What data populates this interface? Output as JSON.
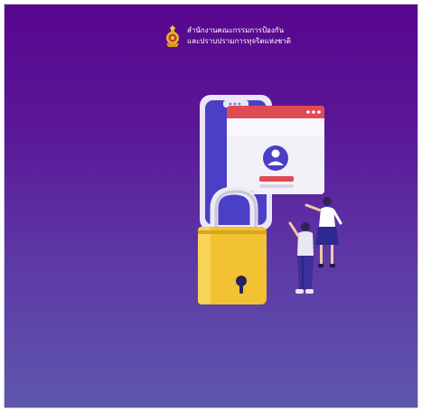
{
  "header": {
    "emblem_icon": "royal-emblem-icon",
    "org_name_line1": "สำนักงานคณะกรรมการป้องกัน",
    "org_name_line2": "และปราบปรามการทุจริตแห่งชาติ"
  },
  "illustration": {
    "phone_icon": "smartphone-icon",
    "login_window_icon": "login-window-icon",
    "user_icon": "user-avatar-icon",
    "lock_icon": "padlock-icon",
    "people_icon": "two-people-icon"
  },
  "colors": {
    "background_top": "#57068e",
    "background_bottom": "#5e57ad",
    "lock_yellow": "#f3c233",
    "window_red": "#e04a55",
    "phone_blue": "#4a3fc6"
  }
}
